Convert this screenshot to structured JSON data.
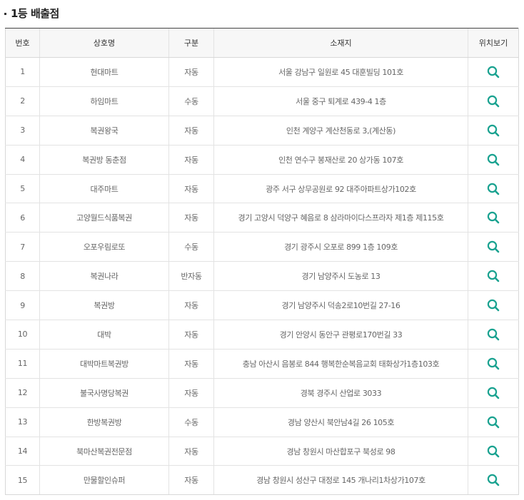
{
  "heading": "1등 배출점",
  "columns": {
    "no": "번호",
    "name": "상호명",
    "type": "구분",
    "address": "소재지",
    "location": "위치보기"
  },
  "accent": "#1aa290",
  "rows": [
    {
      "no": "1",
      "name": "현대마트",
      "type": "자동",
      "address": "서울 강남구 일원로 45 대훈빌딩 101호"
    },
    {
      "no": "2",
      "name": "하임마트",
      "type": "수동",
      "address": "서울 중구 퇴계로 439-4 1층"
    },
    {
      "no": "3",
      "name": "복권왕국",
      "type": "자동",
      "address": "인천 계양구 계산천동로 3,(계산동)"
    },
    {
      "no": "4",
      "name": "복권방 동춘점",
      "type": "자동",
      "address": "인천 연수구 봉재산로 20 상가동 107호"
    },
    {
      "no": "5",
      "name": "대주마트",
      "type": "자동",
      "address": "광주 서구 상무공원로 92 대주아파트상가102호"
    },
    {
      "no": "6",
      "name": "고양월드식품복권",
      "type": "자동",
      "address": "경기 고양시 덕양구 혜음로 8 삼라마이다스프라자 제1층 제115호"
    },
    {
      "no": "7",
      "name": "오포우림로또",
      "type": "수동",
      "address": "경기 광주시 오포로 899 1층 109호"
    },
    {
      "no": "8",
      "name": "복권나라",
      "type": "반자동",
      "address": "경기 남양주시 도농로 13"
    },
    {
      "no": "9",
      "name": "복권방",
      "type": "자동",
      "address": "경기 남양주시 덕송2로10번길 27-16"
    },
    {
      "no": "10",
      "name": "대박",
      "type": "자동",
      "address": "경기 안양시 동안구 관평로170번길 33"
    },
    {
      "no": "11",
      "name": "대박마트복권방",
      "type": "자동",
      "address": "충남 아산시 음봉로 844 행복한순복음교회 태화상가1층103호"
    },
    {
      "no": "12",
      "name": "불국사명당복권",
      "type": "자동",
      "address": "경북 경주시 산업로 3033"
    },
    {
      "no": "13",
      "name": "한방복권방",
      "type": "수동",
      "address": "경남 양산시 북안남4길 26 105호"
    },
    {
      "no": "14",
      "name": "북마산복권전문점",
      "type": "자동",
      "address": "경남 창원시 마산합포구 북성로 98"
    },
    {
      "no": "15",
      "name": "만물할인슈퍼",
      "type": "자동",
      "address": "경남 창원시 성산구 대정로 145 개나리1차상가107호"
    }
  ]
}
